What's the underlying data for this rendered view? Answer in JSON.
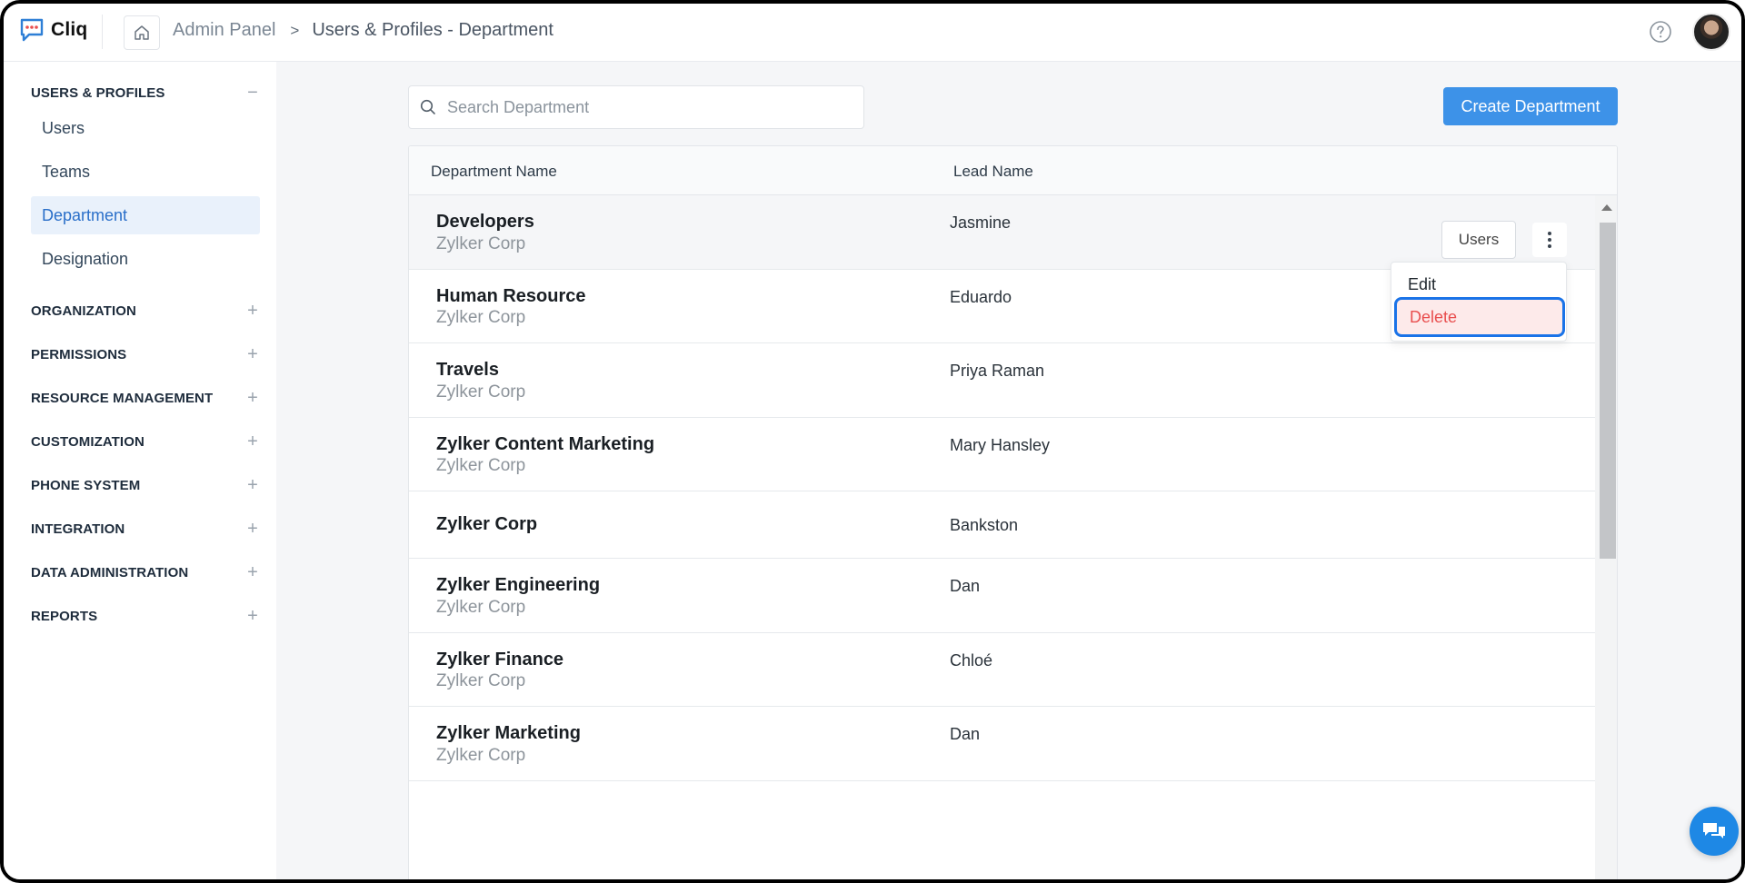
{
  "app": {
    "name": "Cliq",
    "brand_color": "#3d92e8"
  },
  "header": {
    "breadcrumb_root": "Admin Panel",
    "breadcrumb_separator": ">",
    "breadcrumb_current": "Users & Profiles - Department"
  },
  "sidebar": {
    "open_section": {
      "label": "USERS & PROFILES",
      "toggle": "−"
    },
    "items": [
      {
        "label": "Users"
      },
      {
        "label": "Teams"
      },
      {
        "label": "Department",
        "active": true
      },
      {
        "label": "Designation"
      }
    ],
    "sections": [
      {
        "label": "ORGANIZATION",
        "toggle": "+"
      },
      {
        "label": "PERMISSIONS",
        "toggle": "+"
      },
      {
        "label": "RESOURCE MANAGEMENT",
        "toggle": "+"
      },
      {
        "label": "CUSTOMIZATION",
        "toggle": "+"
      },
      {
        "label": "PHONE SYSTEM",
        "toggle": "+"
      },
      {
        "label": "INTEGRATION",
        "toggle": "+"
      },
      {
        "label": "DATA ADMINISTRATION",
        "toggle": "+"
      },
      {
        "label": "REPORTS",
        "toggle": "+"
      }
    ]
  },
  "main": {
    "search": {
      "placeholder": "Search Department",
      "value": ""
    },
    "create_button": "Create Department",
    "table": {
      "columns": [
        "Department Name",
        "Lead Name"
      ],
      "rows": [
        {
          "name": "Developers",
          "org": "Zylker Corp",
          "lead": "Jasmine"
        },
        {
          "name": "Human Resource",
          "org": "Zylker Corp",
          "lead": "Eduardo"
        },
        {
          "name": "Travels",
          "org": "Zylker Corp",
          "lead": "Priya Raman"
        },
        {
          "name": "Zylker Content Marketing",
          "org": "Zylker Corp",
          "lead": "Mary Hansley"
        },
        {
          "name": "Zylker Corp",
          "org": "",
          "lead": "Bankston"
        },
        {
          "name": "Zylker Engineering",
          "org": "Zylker Corp",
          "lead": "Dan"
        },
        {
          "name": "Zylker Finance",
          "org": "Zylker Corp",
          "lead": "Chloé"
        },
        {
          "name": "Zylker Marketing",
          "org": "Zylker Corp",
          "lead": "Dan"
        }
      ],
      "row_actions": {
        "users_button": "Users"
      },
      "context_menu": {
        "edit": "Edit",
        "delete": "Delete"
      }
    }
  }
}
